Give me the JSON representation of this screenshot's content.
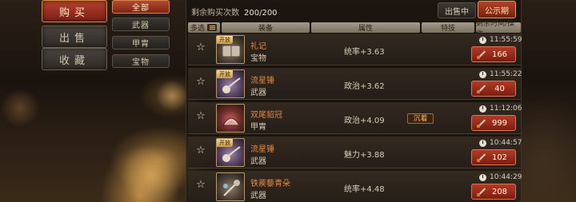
{
  "left_nav": [
    {
      "label": "购买",
      "active": true
    },
    {
      "label": "出售",
      "active": false
    },
    {
      "label": "收藏",
      "active": false
    }
  ],
  "categories": [
    {
      "label": "全部",
      "active": true
    },
    {
      "label": "武器",
      "active": false
    },
    {
      "label": "甲胄",
      "active": false
    },
    {
      "label": "宝物",
      "active": false
    }
  ],
  "header": {
    "remain_label": "剩余购买次数",
    "remain_count": "200/200",
    "selling_label": "出售中",
    "notice_label": "公示期"
  },
  "columns": {
    "multi": "多选",
    "equip": "装备",
    "attr": "属性",
    "skill": "特技",
    "time_price": "剩余时间/操作"
  },
  "rows": [
    {
      "name": "礼记",
      "type": "宝物",
      "attr": "统率+3.63",
      "skill": "",
      "time": "11:55:59",
      "price": "166",
      "open_tag": "开放",
      "icon": "book-icon",
      "icon_color": "#8d7f6a"
    },
    {
      "name": "流星锤",
      "type": "武器",
      "attr": "政治+3.62",
      "skill": "",
      "time": "11:55:22",
      "price": "40",
      "open_tag": "开放",
      "icon": "meteor-hammer-icon",
      "icon_color": "#9d83a8"
    },
    {
      "name": "双尾貂冠",
      "type": "甲胄",
      "attr": "政治+4.09",
      "skill": "沉着",
      "time": "11:12:06",
      "price": "999",
      "open_tag": "",
      "icon": "sable-crown-icon",
      "icon_color": "#c4645a"
    },
    {
      "name": "流星锤",
      "type": "武器",
      "attr": "魅力+3.88",
      "skill": "",
      "time": "10:44:57",
      "price": "102",
      "open_tag": "开放",
      "icon": "meteor-hammer-icon",
      "icon_color": "#9d83a8"
    },
    {
      "name": "铁蒺藜青朵",
      "type": "武器",
      "attr": "统率+4.48",
      "skill": "",
      "time": "10:44:29",
      "price": "208",
      "open_tag": "",
      "icon": "mace-icon",
      "icon_color": "#8d7f6a"
    }
  ]
}
